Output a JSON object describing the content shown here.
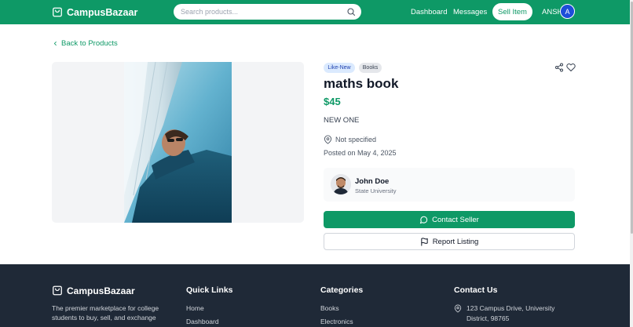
{
  "header": {
    "brand": "CampusBazaar",
    "search_placeholder": "Search products...",
    "nav": {
      "dashboard": "Dashboard",
      "messages": "Messages",
      "sell": "Sell Item",
      "user": "ANSH",
      "avatar_initial": "A"
    }
  },
  "main": {
    "back_label": "Back to Products",
    "product": {
      "condition_badge": "Like-New",
      "category_badge": "Books",
      "title": "maths book",
      "price": "$45",
      "description": "NEW ONE",
      "location": "Not specified",
      "posted": "Posted on May 4, 2025"
    },
    "seller": {
      "name": "John Doe",
      "school": "State University"
    },
    "contact_label": "Contact Seller",
    "report_label": "Report Listing"
  },
  "footer": {
    "brand": "CampusBazaar",
    "tagline": "The premier marketplace for college students to buy, sell, and exchange",
    "quick_links": {
      "heading": "Quick Links",
      "items": [
        "Home",
        "Dashboard"
      ]
    },
    "categories": {
      "heading": "Categories",
      "items": [
        "Books",
        "Electronics"
      ]
    },
    "contact": {
      "heading": "Contact Us",
      "address": "123 Campus Drive, University District, 98765"
    }
  },
  "colors": {
    "brand_green": "#0e9966",
    "footer_bg": "#1f2937",
    "badge_condition_bg": "#dbeafe",
    "avatar_blue": "#1d4ed8"
  },
  "icons": [
    "shopping-bag-icon",
    "search-icon",
    "chevron-left-icon",
    "share-icon",
    "heart-icon",
    "map-pin-icon",
    "message-circle-icon",
    "flag-icon"
  ]
}
